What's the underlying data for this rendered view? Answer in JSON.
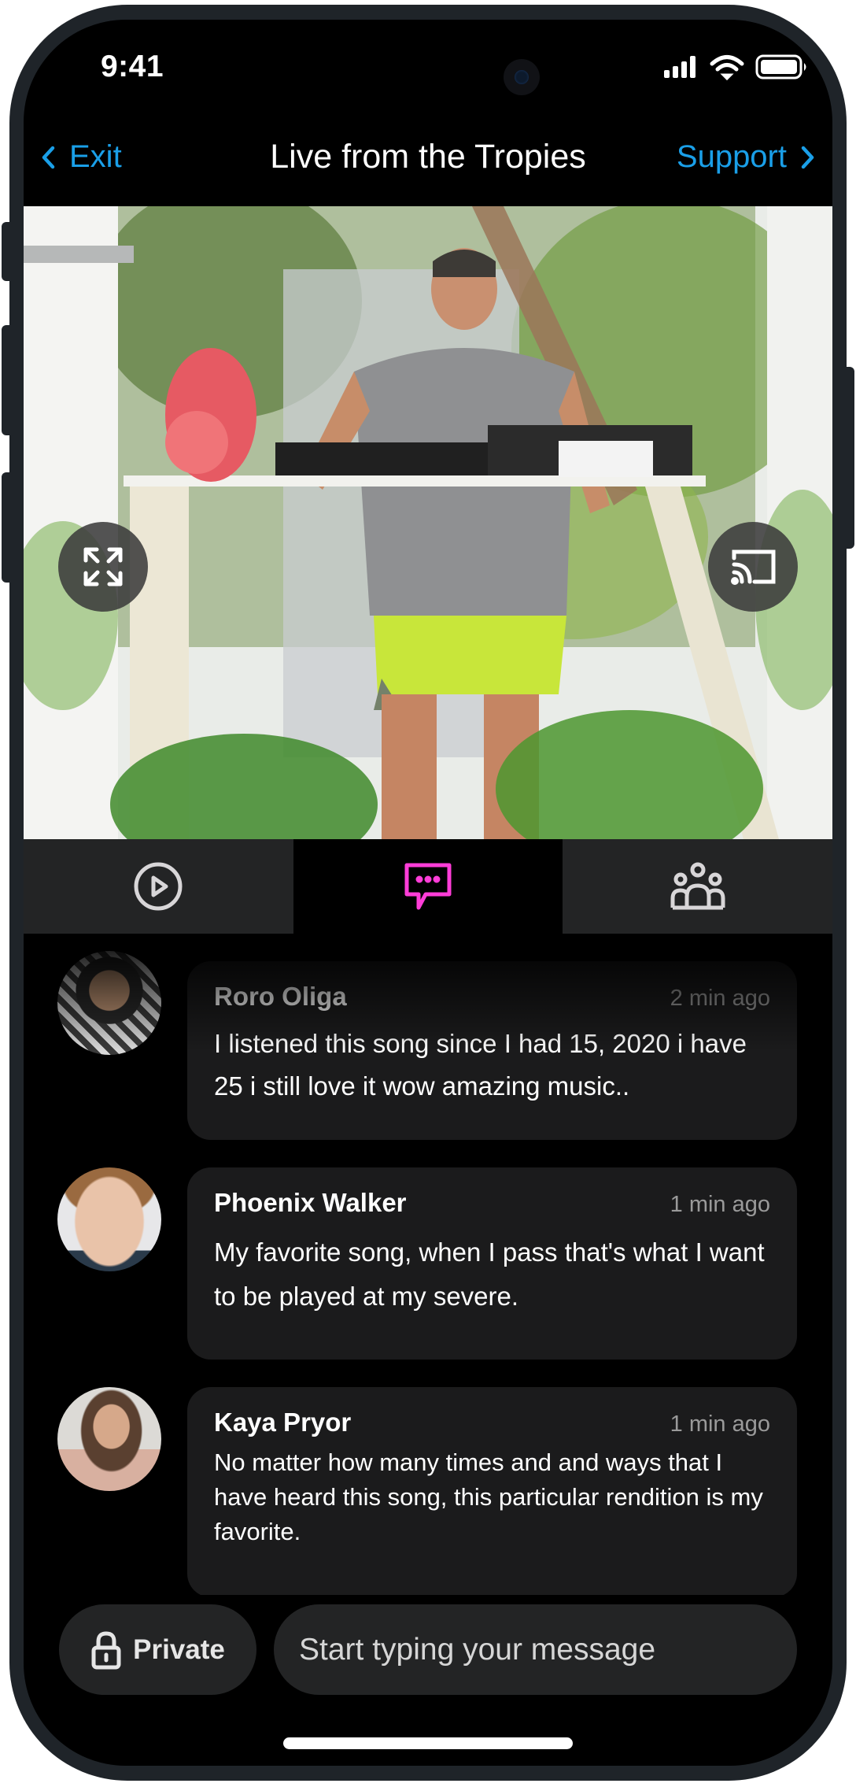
{
  "status_bar": {
    "time": "9:41",
    "icons": [
      "signal-icon",
      "wifi-icon",
      "battery-icon"
    ]
  },
  "nav": {
    "back_label": "Exit",
    "back_icon": "chevron-left-icon",
    "title": "Live from the Tropies",
    "support_label": "Support",
    "support_icon": "chevron-right-icon"
  },
  "video": {
    "description": "DJ performing outdoors among tropical plants",
    "controls": [
      "fullscreen-icon",
      "cast-icon"
    ]
  },
  "tabs": [
    {
      "name": "play",
      "icon": "play-circle-icon",
      "active": false
    },
    {
      "name": "chat",
      "icon": "chat-bubble-icon",
      "active": true
    },
    {
      "name": "audience",
      "icon": "group-icon",
      "active": false
    }
  ],
  "messages": [
    {
      "name": "Roro Oliga",
      "time": "2 min ago",
      "text": "I listened this song since I had 15, 2020 i have 25 i still love it wow amazing music.."
    },
    {
      "name": "Phoenix Walker",
      "time": "1 min ago",
      "text": "My favorite song, when I pass that's what I want to be played at my severe."
    },
    {
      "name": "Kaya Pryor",
      "time": "1 min ago",
      "text": "No matter how many times and and ways that I have heard this song, this particular rendition is my favorite."
    }
  ],
  "composer": {
    "private_label": "Private",
    "private_icon": "lock-icon",
    "placeholder": "Start typing your message",
    "value": ""
  },
  "colors": {
    "accent_blue": "#1a9fe8",
    "active_tab_icon": "#ff3dd8",
    "tab_background": "#232425",
    "bubble_background": "#1b1b1c",
    "frame": "#1f2429"
  }
}
